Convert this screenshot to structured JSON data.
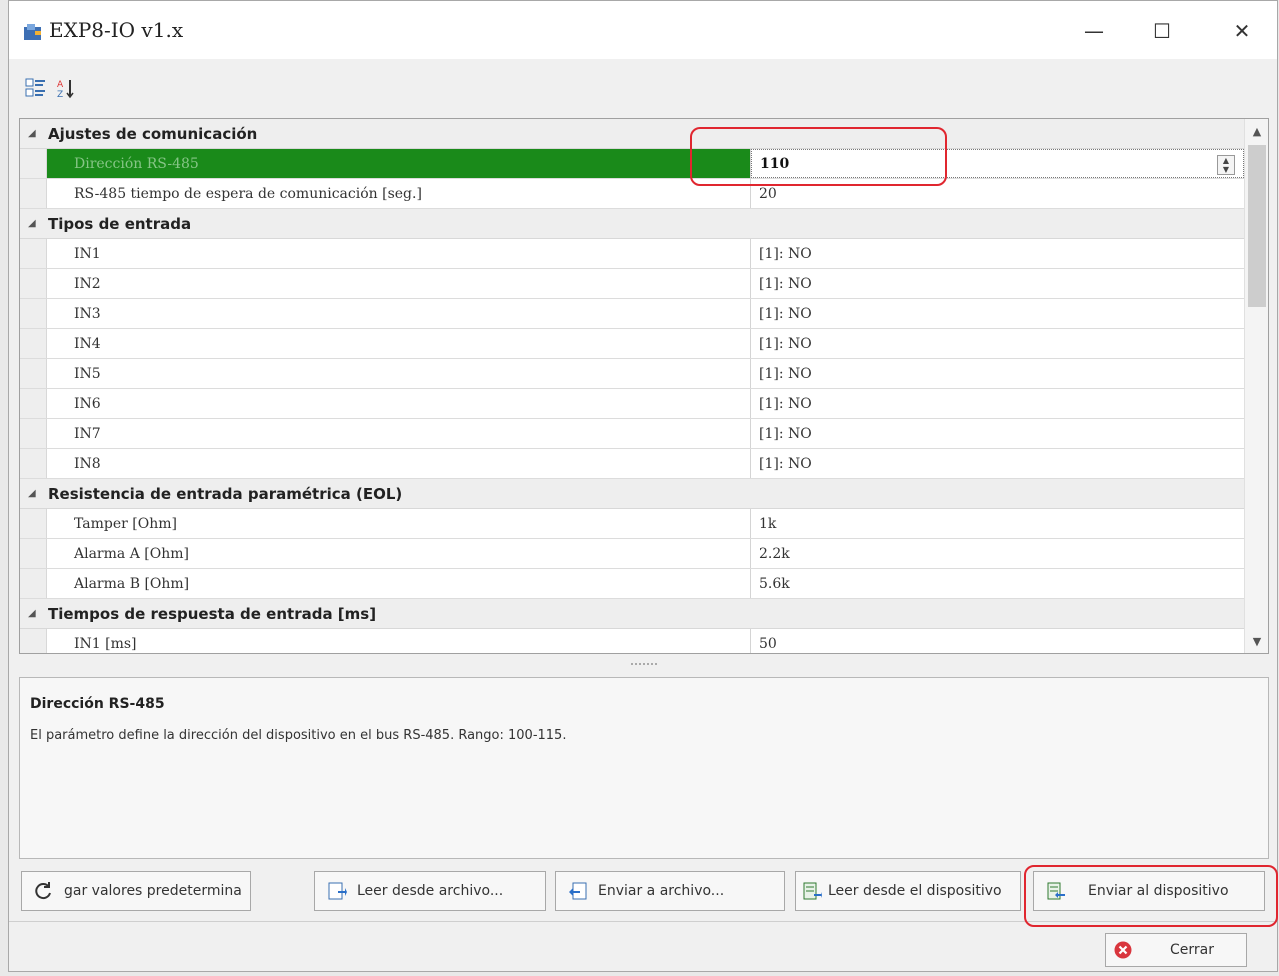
{
  "window": {
    "title": "EXP8-IO v1.x",
    "minimize": "—",
    "maximize": "☐",
    "close": "✕"
  },
  "toolbar": {
    "categorized_icon": "categorized-view-icon",
    "sort_icon": "alphabetical-sort-icon"
  },
  "grid": {
    "categories": [
      {
        "name": "Ajustes de comunicación",
        "props": [
          {
            "name": "Dirección RS-485",
            "value": "110",
            "selected": true
          },
          {
            "name": "RS-485 tiempo de espera de comunicación [seg.]",
            "value": "20"
          }
        ]
      },
      {
        "name": "Tipos de entrada",
        "props": [
          {
            "name": "IN1",
            "value": "[1]: NO"
          },
          {
            "name": "IN2",
            "value": "[1]: NO"
          },
          {
            "name": "IN3",
            "value": "[1]: NO"
          },
          {
            "name": "IN4",
            "value": "[1]: NO"
          },
          {
            "name": "IN5",
            "value": "[1]: NO"
          },
          {
            "name": "IN6",
            "value": "[1]: NO"
          },
          {
            "name": "IN7",
            "value": "[1]: NO"
          },
          {
            "name": "IN8",
            "value": "[1]: NO"
          }
        ]
      },
      {
        "name": "Resistencia de entrada paramétrica (EOL)",
        "props": [
          {
            "name": "Tamper [Ohm]",
            "value": "1k"
          },
          {
            "name": "Alarma A [Ohm]",
            "value": "2.2k"
          },
          {
            "name": "Alarma B [Ohm]",
            "value": "5.6k"
          }
        ]
      },
      {
        "name": "Tiempos de respuesta de entrada [ms]",
        "props": [
          {
            "name": "IN1 [ms]",
            "value": "50"
          }
        ]
      }
    ]
  },
  "description": {
    "title": "Dirección RS-485",
    "text": "El parámetro define la dirección del dispositivo en el bus RS-485. Rango: 100-115."
  },
  "buttons": {
    "defaults": "gar valores predetermina",
    "read_file": "Leer desde archivo...",
    "send_file": "Enviar a archivo...",
    "read_device": "Leer desde el dispositivo",
    "send_device": "Enviar al dispositivo",
    "close": "Cerrar"
  },
  "colors": {
    "selection": "#1a8a1a",
    "highlight": "#e0262f"
  }
}
